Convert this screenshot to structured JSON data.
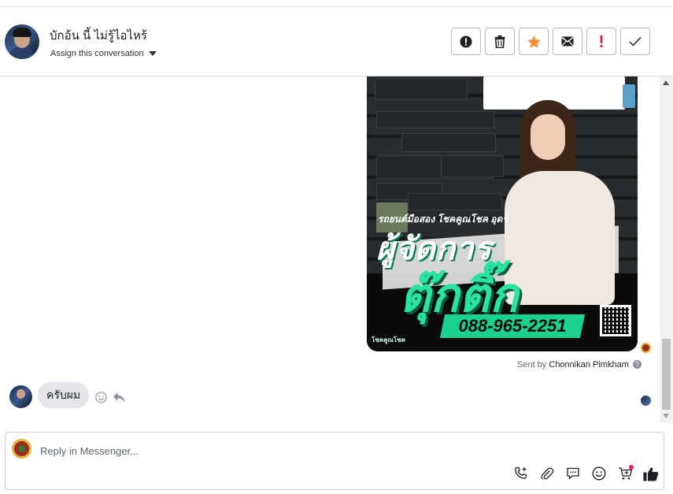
{
  "header": {
    "contact_name": "บักอ้น นี้ ไม่รู้ไอไหร้",
    "assign_label": "Assign this conversation",
    "actions": [
      {
        "icon": "alert-circle-icon"
      },
      {
        "icon": "trash-icon"
      },
      {
        "icon": "star-icon",
        "color": "#f7923b"
      },
      {
        "icon": "envelope-icon"
      },
      {
        "icon": "exclamation-icon",
        "color": "#e41e3f"
      },
      {
        "icon": "checkmark-icon"
      }
    ]
  },
  "thread": {
    "ad_image": {
      "tagline": "รถยนต์มือสอง โชคคูณโชค อุดร",
      "headline1": "ผู้จัดการ",
      "headline2": "ตุ๊กติ๊ก",
      "phone": "088-965-2251",
      "logo_text": "โชคคูณโชค"
    },
    "sent_by_prefix": "Sent by",
    "sent_by_name": "Chonnikan Pimkham",
    "incoming_message": "ครับผม"
  },
  "composer": {
    "placeholder": "Reply in Messenger...",
    "tools": [
      "phone-plus-icon",
      "paperclip-icon",
      "chat-bubble-icon",
      "smiley-icon",
      "cart-icon",
      "thumbs-up-icon"
    ]
  }
}
